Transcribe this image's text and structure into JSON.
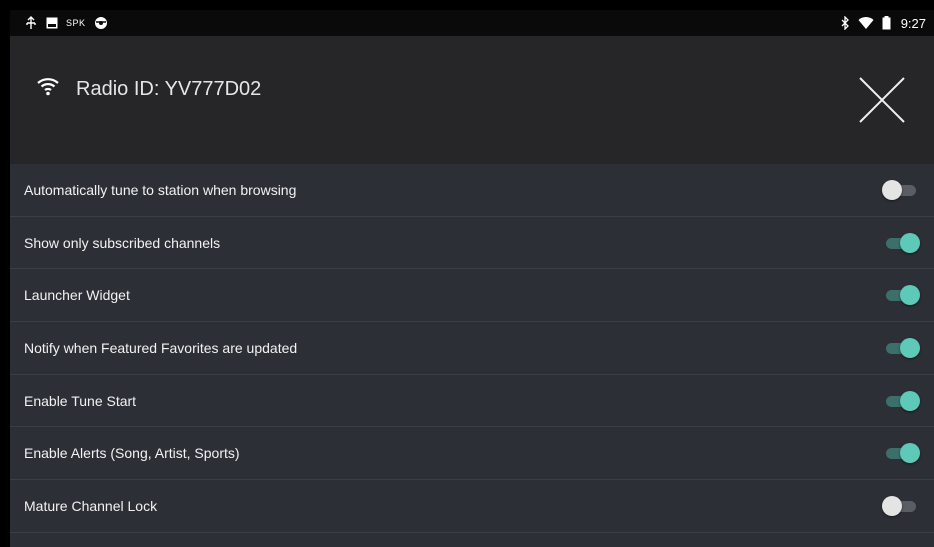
{
  "status_bar": {
    "left_icons": [
      "usb-icon",
      "image-icon",
      "steering-wheel-icon"
    ],
    "spk_text": "SPK",
    "right_icons": [
      "bluetooth-icon",
      "wifi-icon",
      "battery-icon"
    ],
    "time": "9:27"
  },
  "header": {
    "icon": "wifi-icon",
    "title": "Radio ID: YV777D02",
    "close_icon": "close-icon"
  },
  "settings": [
    {
      "label": "Automatically tune to station when browsing",
      "enabled": false
    },
    {
      "label": "Show only subscribed channels",
      "enabled": true
    },
    {
      "label": "Launcher Widget",
      "enabled": true
    },
    {
      "label": "Notify when Featured Favorites are updated",
      "enabled": true
    },
    {
      "label": "Enable Tune Start",
      "enabled": true
    },
    {
      "label": "Enable Alerts (Song, Artist, Sports)",
      "enabled": true
    },
    {
      "label": "Mature Channel Lock",
      "enabled": false
    }
  ],
  "colors": {
    "toggle_on": "#5ec8b9",
    "toggle_off": "#e4e4e4",
    "list_bg": "#2d2f36",
    "header_bg": "#262628"
  }
}
